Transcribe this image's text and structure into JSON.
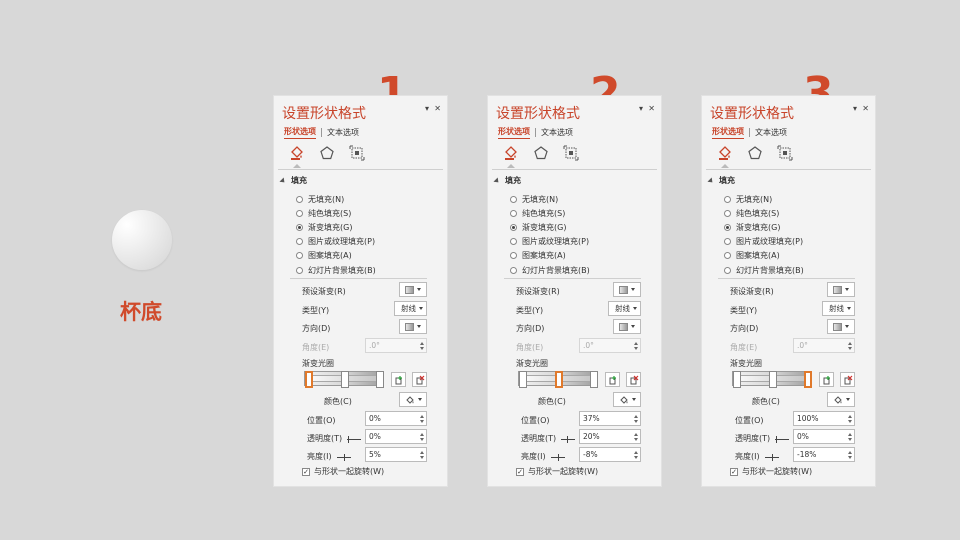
{
  "left": {
    "label": "杯底"
  },
  "accent_color": "#d04a2b",
  "panels": [
    {
      "number": "1",
      "title": "设置形状格式",
      "tab_shape": "形状选项",
      "tab_text": "文本选项",
      "section": "填充",
      "fill_options": [
        "无填充(N)",
        "纯色填充(S)",
        "渐变填充(G)",
        "图片或纹理填充(P)",
        "图案填充(A)",
        "幻灯片背景填充(B)"
      ],
      "selected_fill": 2,
      "preset_label": "预设渐变(R)",
      "type_label": "类型(Y)",
      "type_value": "射线",
      "direction_label": "方向(D)",
      "angle_label": "角度(E)",
      "angle_value": ".0°",
      "stops_label": "渐变光圈",
      "color_label": "颜色(C)",
      "position_label": "位置(O)",
      "position_value": "0%",
      "transparency_label": "透明度(T)",
      "transparency_value": "0%",
      "brightness_label": "亮度(I)",
      "brightness_value": "5%",
      "rotate_label": "与形状一起旋转(W)",
      "active_stop": 0
    },
    {
      "number": "2",
      "title": "设置形状格式",
      "tab_shape": "形状选项",
      "tab_text": "文本选项",
      "section": "填充",
      "fill_options": [
        "无填充(N)",
        "纯色填充(S)",
        "渐变填充(G)",
        "图片或纹理填充(P)",
        "图案填充(A)",
        "幻灯片背景填充(B)"
      ],
      "selected_fill": 2,
      "preset_label": "预设渐变(R)",
      "type_label": "类型(Y)",
      "type_value": "射线",
      "direction_label": "方向(D)",
      "angle_label": "角度(E)",
      "angle_value": ".0°",
      "stops_label": "渐变光圈",
      "color_label": "颜色(C)",
      "position_label": "位置(O)",
      "position_value": "37%",
      "transparency_label": "透明度(T)",
      "transparency_value": "20%",
      "brightness_label": "亮度(I)",
      "brightness_value": "-8%",
      "rotate_label": "与形状一起旋转(W)",
      "active_stop": 1
    },
    {
      "number": "3",
      "title": "设置形状格式",
      "tab_shape": "形状选项",
      "tab_text": "文本选项",
      "section": "填充",
      "fill_options": [
        "无填充(N)",
        "纯色填充(S)",
        "渐变填充(G)",
        "图片或纹理填充(P)",
        "图案填充(A)",
        "幻灯片背景填充(B)"
      ],
      "selected_fill": 2,
      "preset_label": "预设渐变(R)",
      "type_label": "类型(Y)",
      "type_value": "射线",
      "direction_label": "方向(D)",
      "angle_label": "角度(E)",
      "angle_value": ".0°",
      "stops_label": "渐变光圈",
      "color_label": "颜色(C)",
      "position_label": "位置(O)",
      "position_value": "100%",
      "transparency_label": "透明度(T)",
      "transparency_value": "0%",
      "brightness_label": "亮度(I)",
      "brightness_value": "-18%",
      "rotate_label": "与形状一起旋转(W)",
      "active_stop": 2
    }
  ]
}
